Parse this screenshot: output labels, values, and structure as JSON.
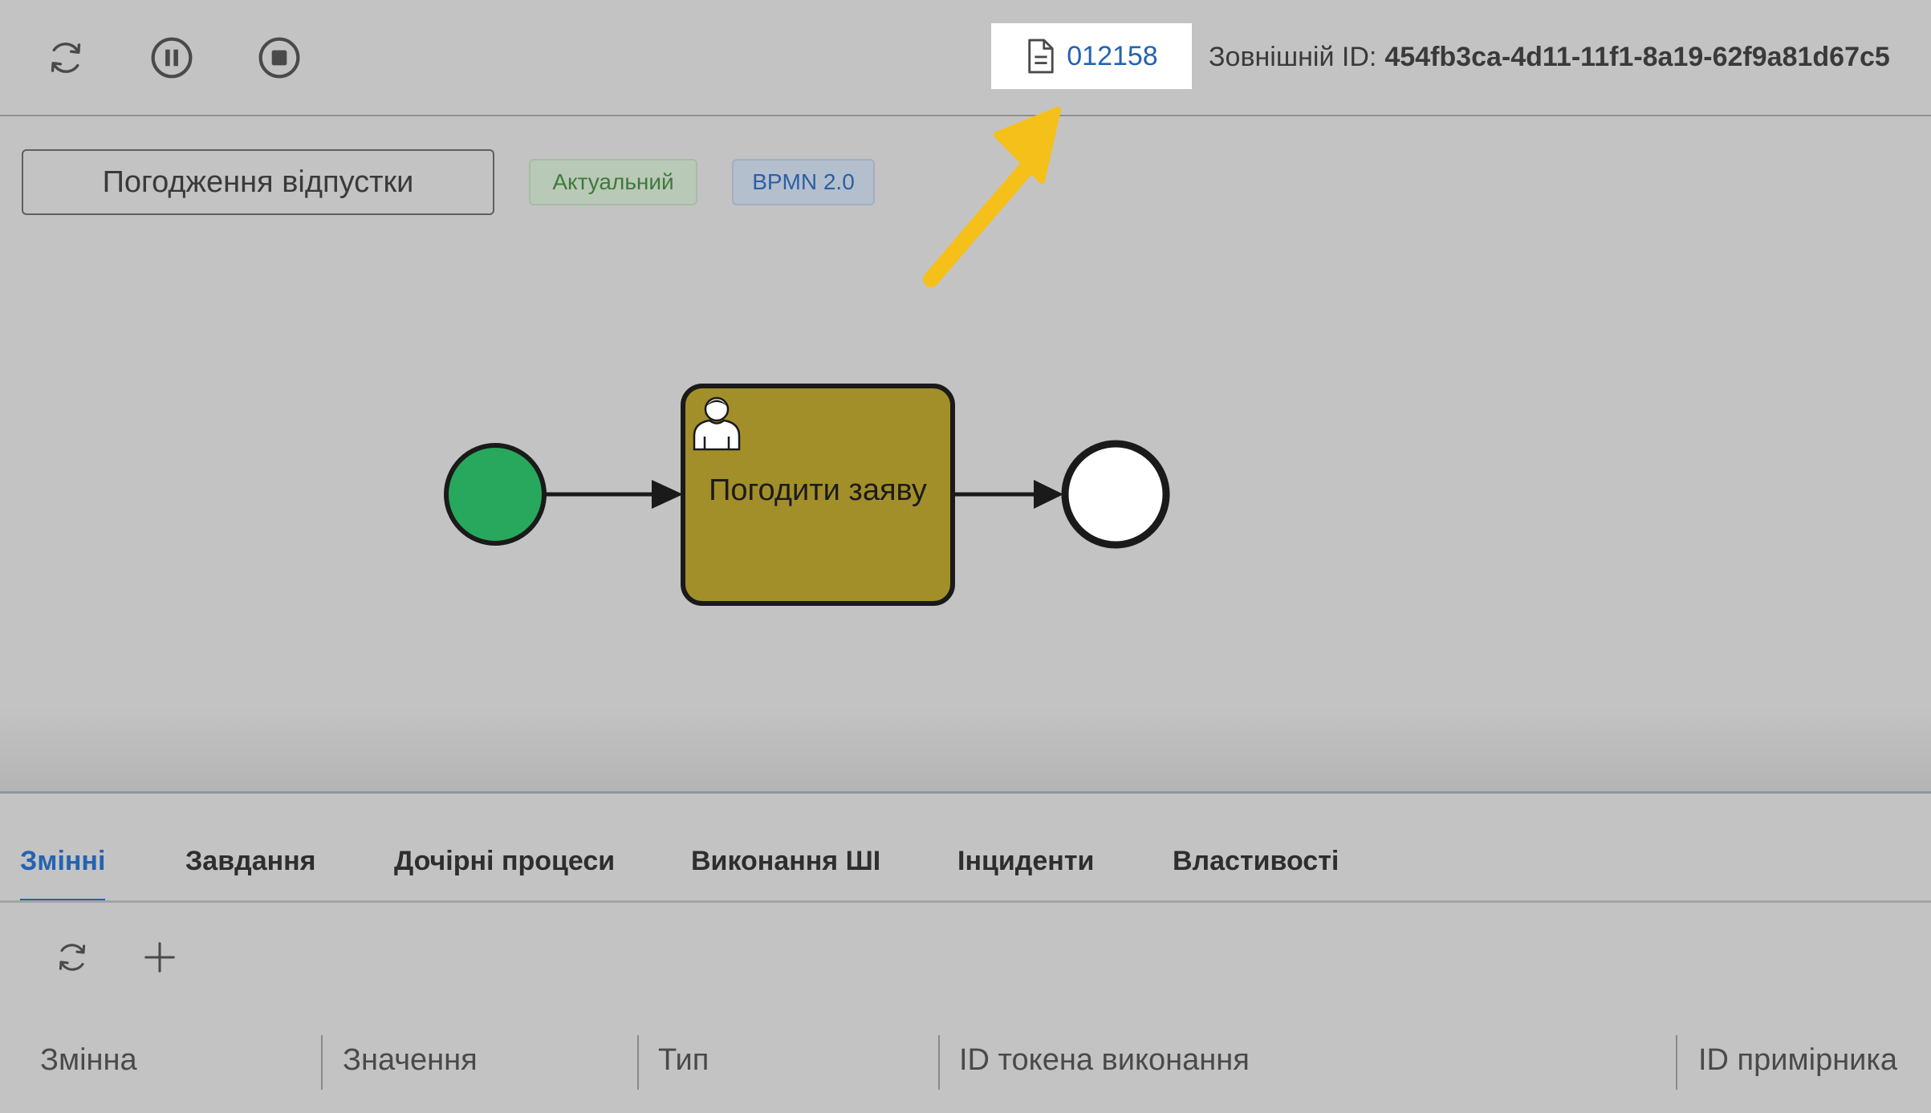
{
  "toolbar": {
    "buttons": [
      {
        "name": "refresh-button",
        "icon": "refresh-icon"
      },
      {
        "name": "pause-button",
        "icon": "pause-circle-icon"
      },
      {
        "name": "stop-button",
        "icon": "stop-circle-icon"
      }
    ],
    "document_number": "012158",
    "external_id_label": "Зовнішній ID:",
    "external_id_value": "454fb3ca-4d11-11f1-8a19-62f9a81d67c5"
  },
  "process": {
    "name": "Погодження відпустки",
    "status_badge": "Актуальний",
    "format_badge": "BPMN 2.0"
  },
  "diagram": {
    "task_label": "Погодити заяву",
    "colors": {
      "start_event": "#27a85c",
      "task_fill": "#a38f29",
      "stroke": "#1a1a1a"
    }
  },
  "annotation": {
    "arrow_color": "#f5c01a"
  },
  "tabs": [
    {
      "label": "Змінні",
      "active": true
    },
    {
      "label": "Завдання",
      "active": false
    },
    {
      "label": "Дочірні процеси",
      "active": false
    },
    {
      "label": "Виконання ШІ",
      "active": false
    },
    {
      "label": "Інциденти",
      "active": false
    },
    {
      "label": "Властивості",
      "active": false
    }
  ],
  "table_tools": [
    {
      "name": "refresh-variables-button",
      "icon": "refresh-icon"
    },
    {
      "name": "add-variable-button",
      "icon": "plus-icon"
    }
  ],
  "table": {
    "columns": [
      "Змінна",
      "Значення",
      "Тип",
      "ID токена виконання",
      "ID примірника"
    ]
  }
}
